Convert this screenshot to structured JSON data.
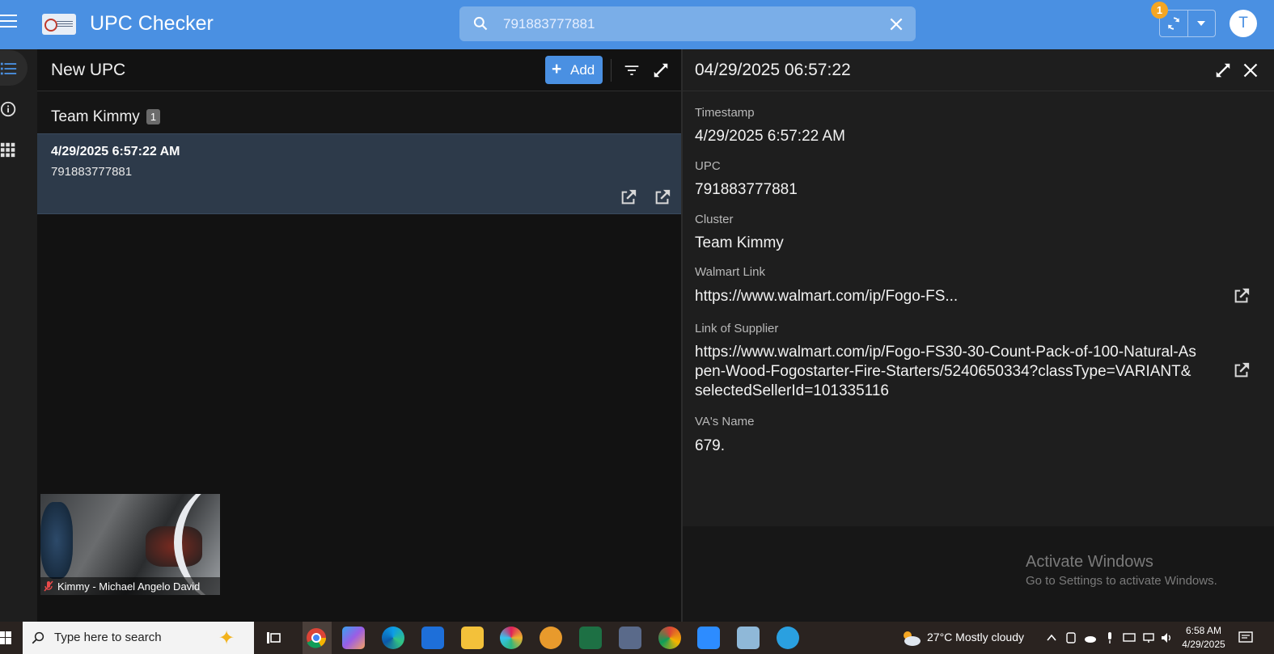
{
  "header": {
    "app_title": "UPC Checker",
    "search_value": "791883777881",
    "sync_badge": "1",
    "avatar_letter": "T"
  },
  "list": {
    "title": "New UPC",
    "add_label": "Add",
    "group_name": "Team Kimmy",
    "group_count": "1",
    "record_time": "4/29/2025 6:57:22 AM",
    "record_upc": "791883777881"
  },
  "video": {
    "label": "Kimmy - Michael Angelo David"
  },
  "detail": {
    "title": "04/29/2025 06:57:22",
    "fields": [
      {
        "label": "Timestamp",
        "value": "4/29/2025 6:57:22 AM"
      },
      {
        "label": "UPC",
        "value": "791883777881"
      },
      {
        "label": "Cluster",
        "value": "Team Kimmy"
      },
      {
        "label": "Walmart Link",
        "value": "https://www.walmart.com/ip/Fogo-FS..."
      },
      {
        "label": "Link of Supplier",
        "value": "https://www.walmart.com/ip/Fogo-FS30-30-Count-Pack-of-100-Natural-Aspen-Wood-Fogostarter-Fire-Starters/5240650334?classType=VARIANT&selectedSellerId=101335116"
      },
      {
        "label": "VA's Name",
        "value": "679."
      }
    ],
    "watermark_title": "Activate Windows",
    "watermark_sub": "Go to Settings to activate Windows."
  },
  "taskbar": {
    "search_placeholder": "Type here to search",
    "weather": "27°C  Mostly cloudy",
    "time": "6:58 AM",
    "date": "4/29/2025"
  },
  "colors": {
    "topbar": "#4a90e2",
    "accent": "#4a90e2",
    "badge": "#f5a623",
    "selected_row": "#2d3a4a"
  }
}
